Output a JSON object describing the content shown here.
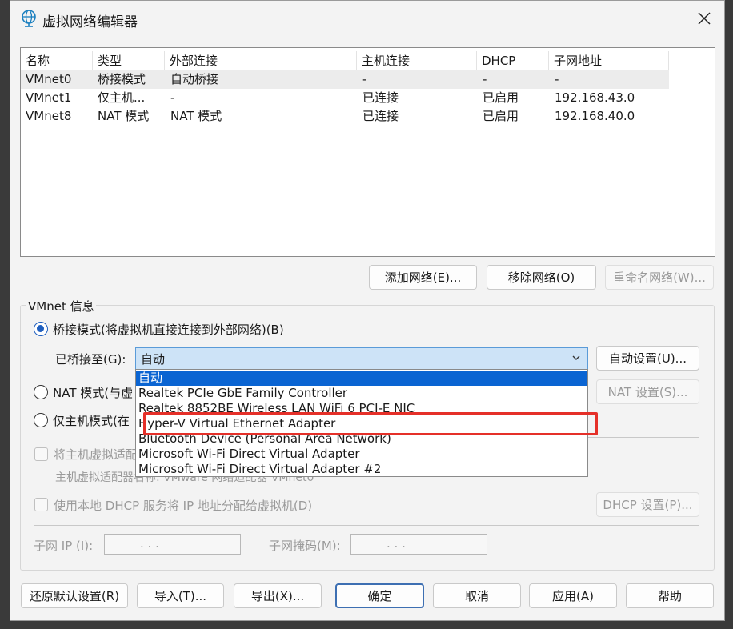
{
  "window": {
    "title": "虚拟网络编辑器",
    "icon": "network-globe-icon",
    "close_label": "✕"
  },
  "network_table": {
    "columns": [
      "名称",
      "类型",
      "外部连接",
      "主机连接",
      "DHCP",
      "子网地址"
    ],
    "rows": [
      [
        "VMnet0",
        "桥接模式",
        "自动桥接",
        "-",
        "-",
        "-"
      ],
      [
        "VMnet1",
        "仅主机...",
        "-",
        "已连接",
        "已启用",
        "192.168.43.0"
      ],
      [
        "VMnet8",
        "NAT 模式",
        "NAT 模式",
        "已连接",
        "已启用",
        "192.168.40.0"
      ]
    ],
    "selected_row": 0
  },
  "list_buttons": {
    "add": "添加网络(E)...",
    "remove": "移除网络(O)",
    "rename": "重命名网络(W)..."
  },
  "vmnet_info": {
    "group_label": "VMnet 信息",
    "bridged_label": "桥接模式(将虚拟机直接连接到外部网络)(B)",
    "bridged_to_label": "已桥接至(G):",
    "bridged_to_value": "自动",
    "auto_settings": "自动设置(U)...",
    "nat_label": "NAT 模式(与虚",
    "nat_settings": "NAT 设置(S)...",
    "hostonly_label": "仅主机模式(在",
    "connect_host_adapter": "将主机虚拟适配",
    "host_adapter_name": "主机虚拟适配器名称: VMware 网络适配器 VMnet0",
    "dhcp_label": "使用本地 DHCP 服务将 IP 地址分配给虚拟机(D)",
    "dhcp_settings": "DHCP 设置(P)...",
    "subnet_ip_label": "子网 IP (I):",
    "subnet_mask_label": "子网掩码(M):",
    "ip_placeholder": ".   .   ."
  },
  "dropdown": {
    "options": [
      "自动",
      "Realtek PCIe GbE Family Controller",
      "Realtek 8852BE Wireless LAN WiFi 6 PCI-E NIC",
      "Hyper-V Virtual Ethernet Adapter",
      "Bluetooth Device (Personal Area Network)",
      "Microsoft Wi-Fi Direct Virtual Adapter",
      "Microsoft Wi-Fi Direct Virtual Adapter #2"
    ],
    "selected_index": 0,
    "highlighted_index": 3,
    "highlight_color": "#e53029"
  },
  "footer": {
    "restore": "还原默认设置(R)",
    "import": "导入(T)...",
    "export": "导出(X)...",
    "ok": "确定",
    "cancel": "取消",
    "apply": "应用(A)",
    "help": "帮助"
  }
}
